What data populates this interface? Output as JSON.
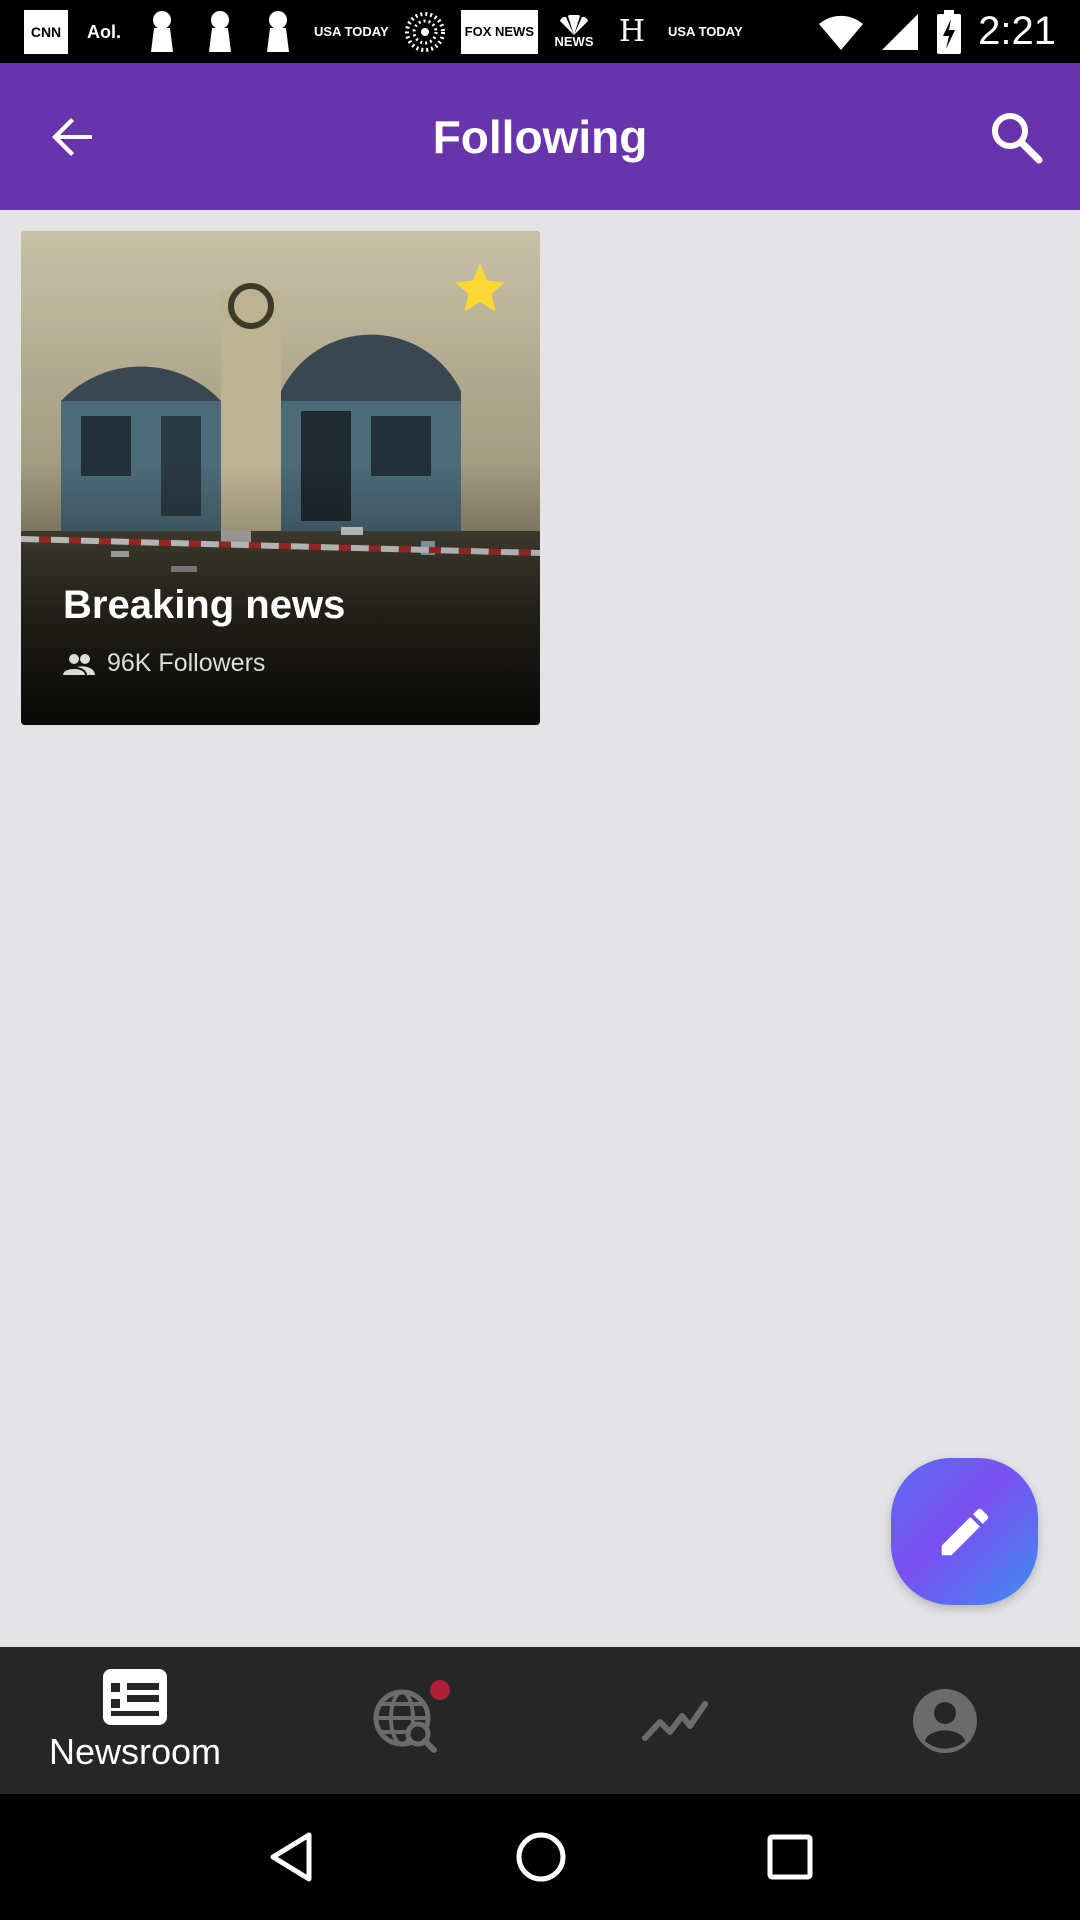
{
  "status_bar": {
    "time": "2:21",
    "notifications": [
      {
        "name": "cnn",
        "label": "CNN"
      },
      {
        "name": "aol",
        "label": "Aol."
      },
      {
        "name": "usa-today-1",
        "label": "USA TODAY"
      },
      {
        "name": "fox-news",
        "label": "FOX NEWS"
      },
      {
        "name": "nbc-news",
        "label": "NEWS"
      },
      {
        "name": "history",
        "label": "H"
      },
      {
        "name": "usa-today-2",
        "label": "USA TODAY"
      }
    ]
  },
  "app_bar": {
    "title": "Following",
    "back_icon": "arrow-back-icon",
    "search_icon": "search-icon"
  },
  "cards": [
    {
      "title": "Breaking news",
      "followers": "96K Followers",
      "starred": true
    }
  ],
  "fab": {
    "icon": "pencil-icon"
  },
  "bottom_nav": {
    "items": [
      {
        "label": "Newsroom",
        "icon": "newsroom-icon",
        "active": true
      },
      {
        "label": "",
        "icon": "globe-search-icon",
        "badge": true
      },
      {
        "label": "",
        "icon": "trending-icon"
      },
      {
        "label": "",
        "icon": "profile-icon"
      }
    ]
  },
  "colors": {
    "app_bar": "#6734ab",
    "background": "#e4e4e7",
    "star": "#fdd835",
    "badge": "#b0203a",
    "nav_bg": "#262626"
  }
}
